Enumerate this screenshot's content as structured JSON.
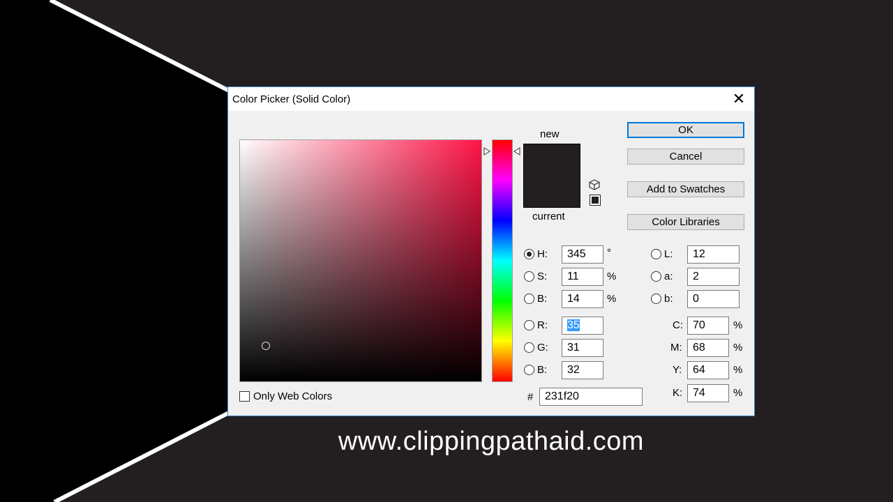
{
  "dialog": {
    "title": "Color Picker (Solid Color)",
    "close_label": "✕",
    "close_icon": "close-icon"
  },
  "preview": {
    "new_label": "new",
    "current_label": "current",
    "new_color": "#231f20",
    "current_color": "#231f20",
    "gamut_warning_icon": "cube-icon",
    "web_safe_icon": "square-icon"
  },
  "buttons": {
    "ok": "OK",
    "cancel": "Cancel",
    "add_to_swatches": "Add to Swatches",
    "color_libraries": "Color Libraries"
  },
  "hsb": {
    "h": {
      "label": "H:",
      "value": "345",
      "unit": "°",
      "selected": true
    },
    "s": {
      "label": "S:",
      "value": "11",
      "unit": "%",
      "selected": false
    },
    "b": {
      "label": "B:",
      "value": "14",
      "unit": "%",
      "selected": false
    }
  },
  "rgb": {
    "r": {
      "label": "R:",
      "value": "35",
      "selected": false
    },
    "g": {
      "label": "G:",
      "value": "31",
      "selected": false
    },
    "b": {
      "label": "B:",
      "value": "32",
      "selected": false
    }
  },
  "lab": {
    "l": {
      "label": "L:",
      "value": "12"
    },
    "a": {
      "label": "a:",
      "value": "2"
    },
    "b": {
      "label": "b:",
      "value": "0"
    }
  },
  "cmyk": {
    "c": {
      "label": "C:",
      "value": "70",
      "unit": "%"
    },
    "m": {
      "label": "M:",
      "value": "68",
      "unit": "%"
    },
    "y": {
      "label": "Y:",
      "value": "64",
      "unit": "%"
    },
    "k": {
      "label": "K:",
      "value": "74",
      "unit": "%"
    }
  },
  "hex": {
    "label": "#",
    "value": "231f20"
  },
  "only_web_colors": {
    "label": "Only Web Colors",
    "checked": false
  },
  "field": {
    "hue_color": "#ff1447"
  },
  "watermark": "www.clippingpathaid.com"
}
